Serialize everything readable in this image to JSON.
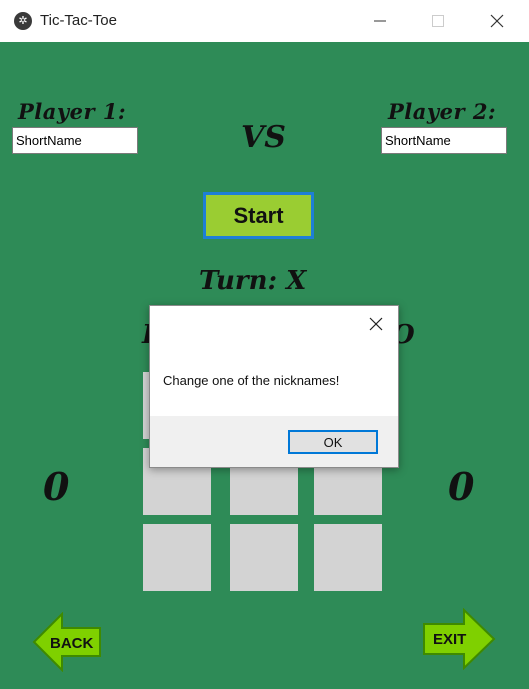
{
  "window": {
    "title": "Tic-Tac-Toe",
    "icon": "app-logo-icon",
    "minimize": "—",
    "maximize": "☐",
    "close": "✕"
  },
  "players": {
    "player1_label": "Player 1:",
    "player2_label": "Player 2:",
    "player1_name": "ShortName",
    "player2_name": "ShortName",
    "vs_label": "VS"
  },
  "controls": {
    "start_label": "Start",
    "turn_text": "Turn: X",
    "back_label": "BACK",
    "exit_label": "EXIT"
  },
  "scores": {
    "left": "0",
    "right": "0"
  },
  "board": {
    "cells": [
      "",
      "",
      "",
      "",
      "",
      "",
      "",
      "",
      ""
    ]
  },
  "dialog": {
    "message": "Change one of the nicknames!",
    "ok_label": "OK",
    "close_glyph": "✕"
  },
  "colors": {
    "background": "#2e8b57",
    "cell": "#d3d3d3",
    "start_button": "#9acd32",
    "arrow": "#7fd000",
    "focus_border": "#0078d7"
  }
}
